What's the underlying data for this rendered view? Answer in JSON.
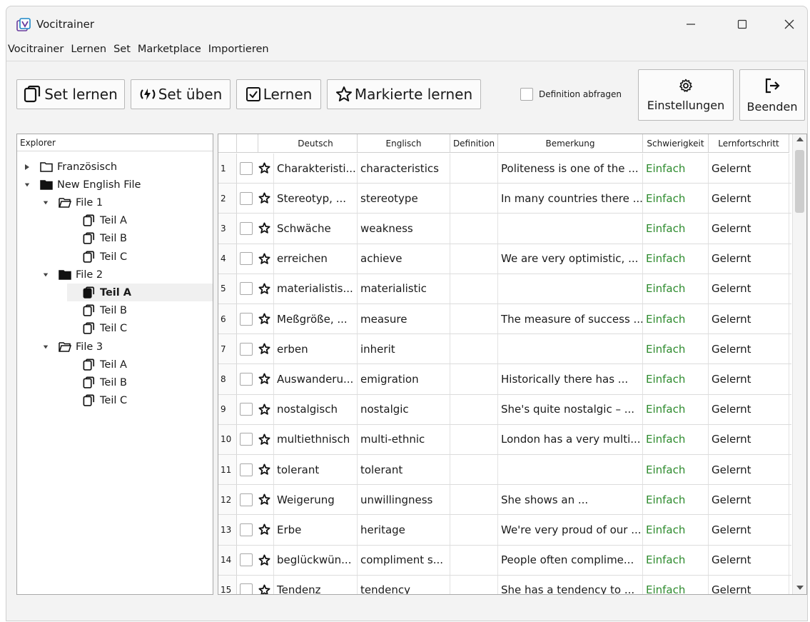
{
  "window": {
    "title": "Vocitrainer"
  },
  "menu": [
    "Vocitrainer",
    "Lernen",
    "Set",
    "Marketplace",
    "Importieren"
  ],
  "toolbar": {
    "set_lernen": "Set lernen",
    "set_ueben": "Set üben",
    "lernen": "Lernen",
    "markierte_lernen": "Markierte lernen",
    "definition_abfragen": "Definition abfragen",
    "einstellungen": "Einstellungen",
    "beenden": "Beenden"
  },
  "explorer": {
    "header": "Explorer",
    "items": [
      {
        "label": "Französisch",
        "level": 0,
        "type": "folder",
        "expanded": false
      },
      {
        "label": "New English File",
        "level": 0,
        "type": "folder-filled",
        "expanded": true
      },
      {
        "label": "File 1",
        "level": 1,
        "type": "folder-open",
        "expanded": true
      },
      {
        "label": "Teil A",
        "level": 2,
        "type": "set"
      },
      {
        "label": "Teil B",
        "level": 2,
        "type": "set"
      },
      {
        "label": "Teil C",
        "level": 2,
        "type": "set"
      },
      {
        "label": "File 2",
        "level": 1,
        "type": "folder-filled",
        "expanded": true
      },
      {
        "label": "Teil A",
        "level": 2,
        "type": "set-filled",
        "selected": true
      },
      {
        "label": "Teil B",
        "level": 2,
        "type": "set"
      },
      {
        "label": "Teil C",
        "level": 2,
        "type": "set"
      },
      {
        "label": "File 3",
        "level": 1,
        "type": "folder-open",
        "expanded": true
      },
      {
        "label": "Teil A",
        "level": 2,
        "type": "set"
      },
      {
        "label": "Teil B",
        "level": 2,
        "type": "set"
      },
      {
        "label": "Teil C",
        "level": 2,
        "type": "set"
      }
    ]
  },
  "table": {
    "headers": [
      "Deutsch",
      "Englisch",
      "Definition",
      "Bemerkung",
      "Schwierigkeit",
      "Lernfortschritt"
    ],
    "rows": [
      {
        "n": "1",
        "deutsch": "Charakteristi...",
        "englisch": "characteristics",
        "definition": "",
        "bemerkung": "Politeness is one of the ...",
        "schwierigkeit": "Einfach",
        "fortschritt": "Gelernt"
      },
      {
        "n": "2",
        "deutsch": "Stereotyp, ...",
        "englisch": "stereotype",
        "definition": "",
        "bemerkung": "In many countries there ...",
        "schwierigkeit": "Einfach",
        "fortschritt": "Gelernt"
      },
      {
        "n": "3",
        "deutsch": "Schwäche",
        "englisch": "weakness",
        "definition": "",
        "bemerkung": "",
        "schwierigkeit": "Einfach",
        "fortschritt": "Gelernt"
      },
      {
        "n": "4",
        "deutsch": "erreichen",
        "englisch": "achieve",
        "definition": "",
        "bemerkung": "We are very optimistic, ...",
        "schwierigkeit": "Einfach",
        "fortschritt": "Gelernt"
      },
      {
        "n": "5",
        "deutsch": "materialistis...",
        "englisch": "materialistic",
        "definition": "",
        "bemerkung": "",
        "schwierigkeit": "Einfach",
        "fortschritt": "Gelernt"
      },
      {
        "n": "6",
        "deutsch": "Meßgröße, ...",
        "englisch": "measure",
        "definition": "",
        "bemerkung": "The measure of success ...",
        "schwierigkeit": "Einfach",
        "fortschritt": "Gelernt"
      },
      {
        "n": "7",
        "deutsch": "erben",
        "englisch": "inherit",
        "definition": "",
        "bemerkung": "",
        "schwierigkeit": "Einfach",
        "fortschritt": "Gelernt"
      },
      {
        "n": "8",
        "deutsch": "Auswanderu...",
        "englisch": "emigration",
        "definition": "",
        "bemerkung": "Historically there has ...",
        "schwierigkeit": "Einfach",
        "fortschritt": "Gelernt"
      },
      {
        "n": "9",
        "deutsch": "nostalgisch",
        "englisch": "nostalgic",
        "definition": "",
        "bemerkung": "She's quite nostalgic – ...",
        "schwierigkeit": "Einfach",
        "fortschritt": "Gelernt"
      },
      {
        "n": "10",
        "deutsch": "multiethnisch",
        "englisch": "multi-ethnic",
        "definition": "",
        "bemerkung": "London has a very multi...",
        "schwierigkeit": "Einfach",
        "fortschritt": "Gelernt"
      },
      {
        "n": "11",
        "deutsch": "tolerant",
        "englisch": "tolerant",
        "definition": "",
        "bemerkung": "",
        "schwierigkeit": "Einfach",
        "fortschritt": "Gelernt"
      },
      {
        "n": "12",
        "deutsch": "Weigerung",
        "englisch": "unwillingness",
        "definition": "",
        "bemerkung": "She shows an ...",
        "schwierigkeit": "Einfach",
        "fortschritt": "Gelernt"
      },
      {
        "n": "13",
        "deutsch": "Erbe",
        "englisch": "heritage",
        "definition": "",
        "bemerkung": "We're very proud of our ...",
        "schwierigkeit": "Einfach",
        "fortschritt": "Gelernt"
      },
      {
        "n": "14",
        "deutsch": "beglückwün...",
        "englisch": "compliment s...",
        "definition": "",
        "bemerkung": "People often complime...",
        "schwierigkeit": "Einfach",
        "fortschritt": "Gelernt"
      },
      {
        "n": "15",
        "deutsch": "Tendenz",
        "englisch": "tendency",
        "definition": "",
        "bemerkung": "She has a tendency to ...",
        "schwierigkeit": "Einfach",
        "fortschritt": "Gelernt"
      }
    ]
  },
  "colors": {
    "accent": "#6b3fa0",
    "easy": "#2e8b2e"
  }
}
